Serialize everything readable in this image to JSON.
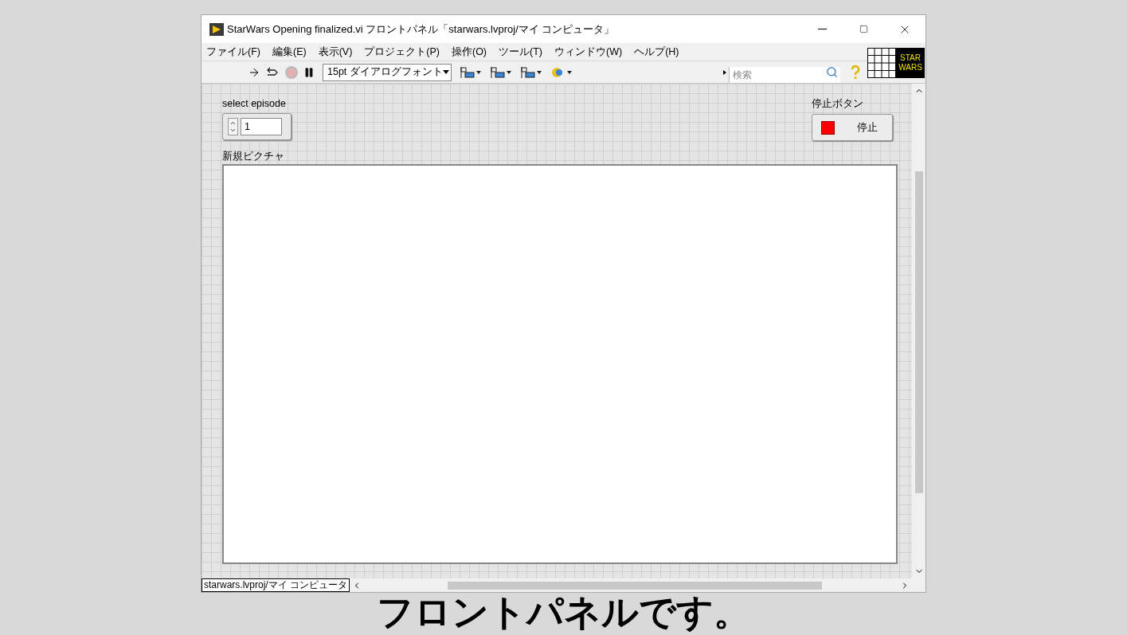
{
  "window": {
    "title": "StarWars Opening finalized.vi フロントパネル「starwars.lvproj/マイ コンピュータ」"
  },
  "menu": [
    "ファイル(F)",
    "編集(E)",
    "表示(V)",
    "プロジェクト(P)",
    "操作(O)",
    "ツール(T)",
    "ウィンドウ(W)",
    "ヘルプ(H)"
  ],
  "toolbar": {
    "font_menu": "15pt ダイアログフォント",
    "search": {
      "placeholder": "検索"
    }
  },
  "vi_icon": {
    "lines": [
      "STAR",
      "WARS"
    ]
  },
  "controls": [
    {
      "kind": "numeric",
      "label": "select episode",
      "value": "1"
    },
    {
      "kind": "button",
      "label": "停止ボタン",
      "text": "停止"
    },
    {
      "kind": "picture",
      "label": "新規ピクチャ"
    }
  ],
  "status_bar": {
    "context": "starwars.lvproj/マイ コンピュータ"
  },
  "caption": "フロントパネルです。"
}
